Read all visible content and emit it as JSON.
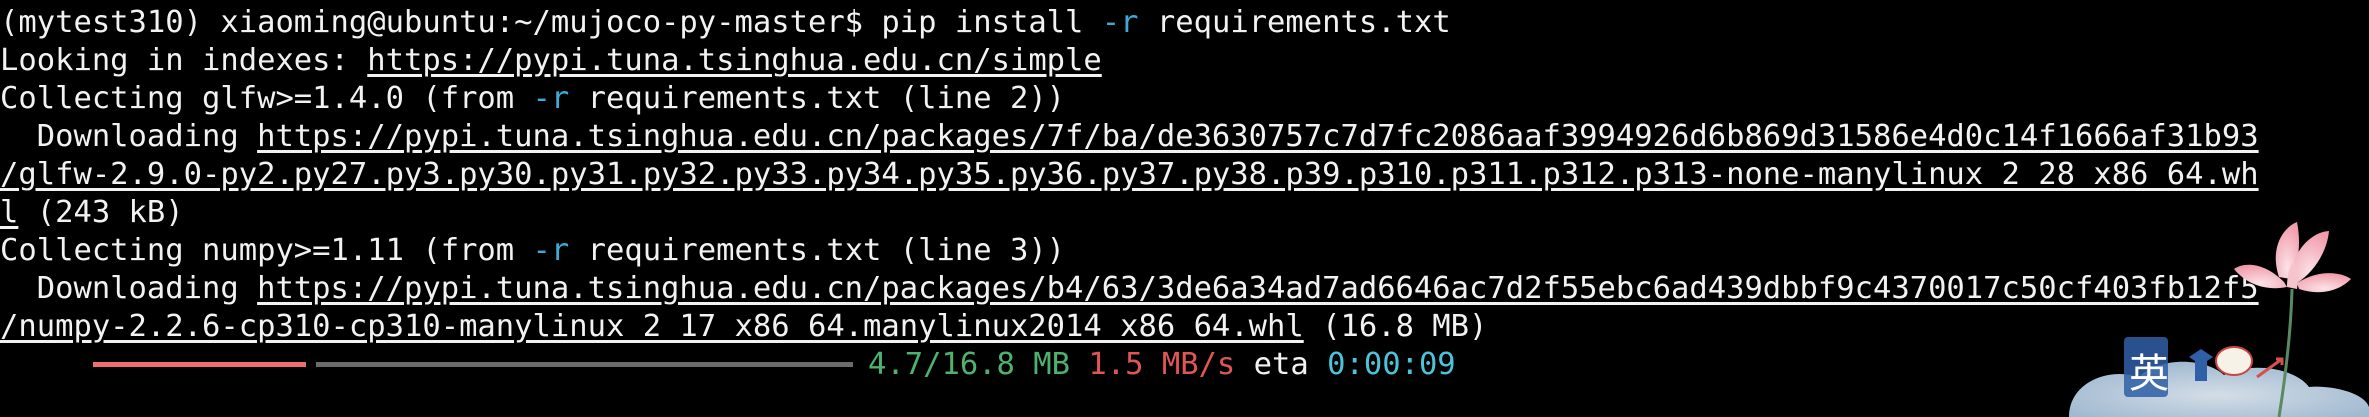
{
  "colors": {
    "background": "#000000",
    "text": "#f2f2f2",
    "flag": "#3fa9d6",
    "progress_done": "#ef6f6f",
    "progress_rest": "#6b6b6b",
    "size_text": "#4db26e",
    "speed_text": "#e05656",
    "eta_text": "#4cc3d9"
  },
  "lines": {
    "prompt": {
      "env": "(mytest310) ",
      "user_host": "xiaoming@ubuntu:~/mujoco-py-master$ ",
      "cmd": "pip install ",
      "flag": "-r",
      "args": " requirements.txt"
    },
    "index": {
      "label": "Looking in indexes: ",
      "url": "https://pypi.tuna.tsinghua.edu.cn/simple"
    },
    "glfw_collect": {
      "pre": "Collecting glfw>=1.4.0 (from ",
      "flag": "-r",
      "post": " requirements.txt (line 2))"
    },
    "glfw_download": {
      "pre": "  Downloading ",
      "url_part1": "https://pypi.tuna.tsinghua.edu.cn/packages/7f/ba/de3630757c7d7fc2086aaf3994926d6b869d31586e4d0c14f1666af31b93",
      "url_part2": "/glfw-2.9.0-py2.py27.py3.py30.py31.py32.py33.py34.py35.py36.py37.py38.p39.p310.p311.p312.p313-none-manylinux_2_28_x86_64.wh",
      "url_part3": "l",
      "size": " (243 kB)"
    },
    "numpy_collect": {
      "pre": "Collecting numpy>=1.11 (from ",
      "flag": "-r",
      "post": " requirements.txt (line 3))"
    },
    "numpy_download": {
      "pre": "  Downloading ",
      "url_part1": "https://pypi.tuna.tsinghua.edu.cn/packages/b4/63/3de6a34ad7ad6646ac7d2f55ebc6ad439dbbf9c4370017c50cf403fb12f5",
      "url_part2": "/numpy-2.2.6-cp310-cp310-manylinux_2_17_x86_64.manylinux2014_x86_64.whl",
      "size": " (16.8 MB)"
    }
  },
  "progress": {
    "fraction": 0.28,
    "downloaded": "4.7/16.8 MB",
    "speed": "1.5 MB/s",
    "eta_label": "eta",
    "eta_value": "0:00:09"
  },
  "decor": {
    "icon": "lotus-decoration-icon",
    "badge_text": "英"
  }
}
